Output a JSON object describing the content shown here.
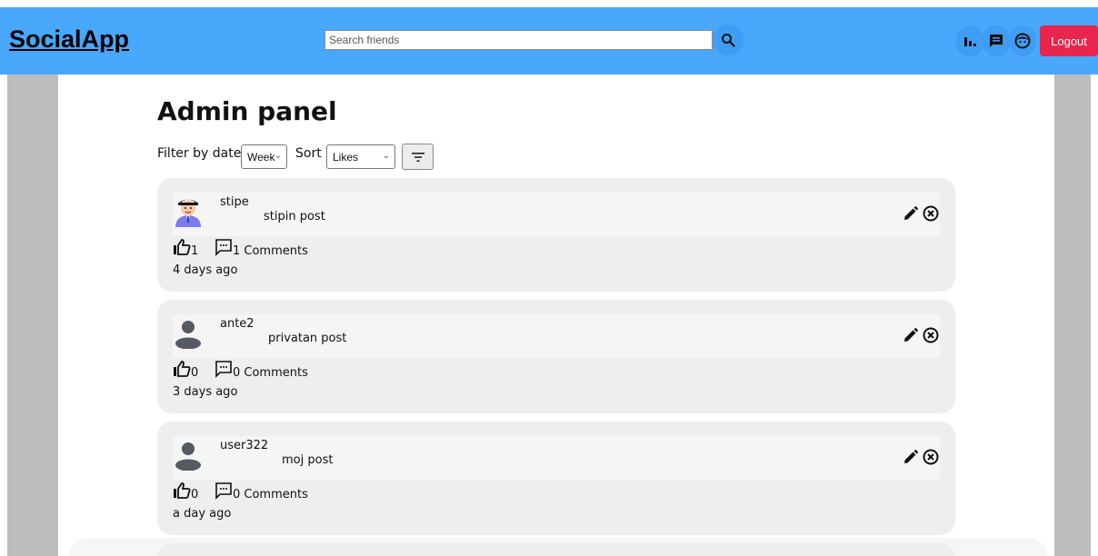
{
  "navbar": {
    "logo": "SocialApp",
    "search_placeholder": "Search friends",
    "search_icon": "search-icon",
    "icons": [
      "bar-chart-icon",
      "chat-icon",
      "profile-face-icon"
    ],
    "logout_label": "Logout",
    "colors": {
      "bar": "#49a7fc",
      "logout": "#e8254c"
    }
  },
  "page": {
    "title": "Admin panel",
    "filter_label": "Filter by date",
    "filter_value": "Week",
    "sort_label": "Sort",
    "sort_value": "Likes",
    "sort_button_icon": "filter-lines-icon"
  },
  "posts": [
    {
      "username": "stipe",
      "text": "stipin post",
      "likes": "1",
      "comments": "1 Comments",
      "time": "4 days ago",
      "avatar": "user-photo-avatar"
    },
    {
      "username": "ante2",
      "text": "privatan post",
      "likes": "0",
      "comments": "0 Comments",
      "time": "3 days ago",
      "avatar": "default-avatar-icon"
    },
    {
      "username": "user322",
      "text": "moj post",
      "likes": "0",
      "comments": "0 Comments",
      "time": "a day ago",
      "avatar": "default-avatar-icon"
    }
  ]
}
